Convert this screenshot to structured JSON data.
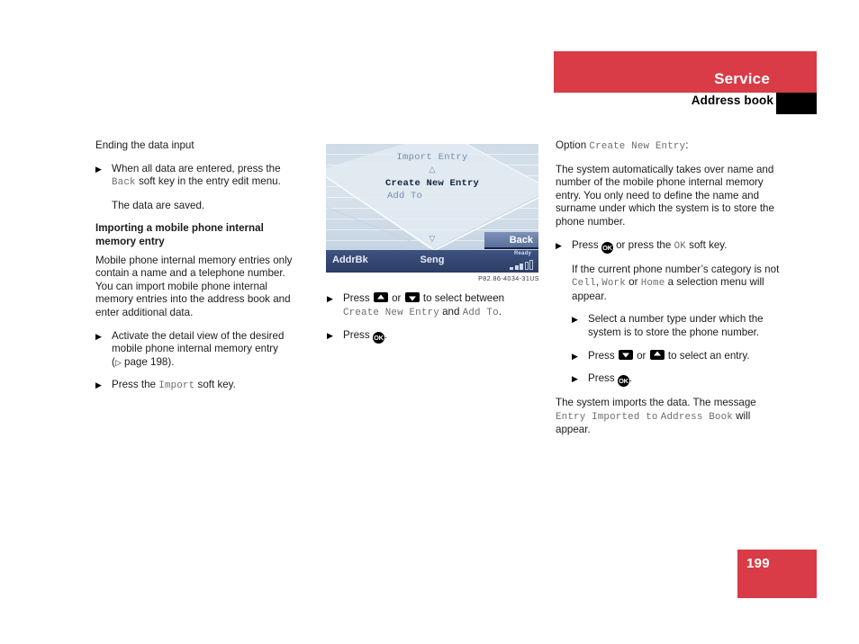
{
  "header": {
    "section": "Service",
    "subsection": "Address book",
    "accent_color": "#d93b47",
    "marker_color": "#000000"
  },
  "page_number": "199",
  "left_column": {
    "heading_plain": "Ending the data input",
    "bullet1_part1": "When all data are entered, press the",
    "bullet1_key": "Back",
    "bullet1_part2": "soft key in the entry edit menu.",
    "note1": "The data are saved.",
    "heading_bold": "Importing a mobile phone internal memory entry",
    "paragraph1": "Mobile phone internal memory entries only contain a name and a telephone number. You can import mobile phone internal memory entries into the address book and enter additional data.",
    "bullet2_part1": "Activate the detail view of the desired mobile phone internal memory entry",
    "bullet2_ref_open": "(",
    "bullet2_ref_tri": "▷",
    "bullet2_ref_text": " page 198).",
    "bullet3_part1": "Press the",
    "bullet3_key": "Import",
    "bullet3_part2": "soft key."
  },
  "device_screen": {
    "title": "Import Entry",
    "scroll_up_glyph": "△",
    "scroll_down_glyph": "▽",
    "option_selected": "Create New Entry",
    "option_other": "Add To",
    "soft_key": "Back",
    "status_left": "AddrBk",
    "status_center": "Seng",
    "status_ready": "Ready",
    "caption": "P82.86-4034-31US"
  },
  "mid_column": {
    "bullet1_part1": "Press",
    "bullet1_key_up": "up-arrow-key",
    "bullet1_or": "or",
    "bullet1_key_down": "down-arrow-key",
    "bullet1_part2": "to select between",
    "bullet1_opt1": "Create New Entry",
    "bullet1_and": "and",
    "bullet1_opt2": "Add To",
    "bullet1_period": ".",
    "bullet2_part1": "Press",
    "bullet2_key_ok": "OK",
    "bullet2_period": "."
  },
  "right_column": {
    "option_label": "Option",
    "option_name": "Create New Entry",
    "option_colon": ":",
    "paragraph1": "The system automatically takes over name and number of the mobile phone internal memory entry. You only need to define the name and surname under which the system is to store the phone number.",
    "bullet1_part1": "Press",
    "bullet1_key_ok": "OK",
    "bullet1_part2": "or press the",
    "bullet1_key_soft": "OK",
    "bullet1_part3": "soft key.",
    "note_part1": "If the current phone number’s category is not",
    "note_cat1": "Cell",
    "note_comma": ",",
    "note_cat2": "Work",
    "note_or": "or",
    "note_cat3": "Home",
    "note_part2": "a selection menu will appear.",
    "bullet2": "Select a number type under which the system is to store the phone number.",
    "bullet3_part1": "Press",
    "bullet3_key_down": "down-arrow-key",
    "bullet3_or": "or",
    "bullet3_key_up": "up-arrow-key",
    "bullet3_part2": "to select an entry.",
    "bullet4_part1": "Press",
    "bullet4_key_ok": "OK",
    "bullet4_period": ".",
    "closing_part1": "The system imports the data. The message",
    "closing_msg1": "Entry Imported to",
    "closing_msg2": "Address Book",
    "closing_part2": "will appear."
  }
}
